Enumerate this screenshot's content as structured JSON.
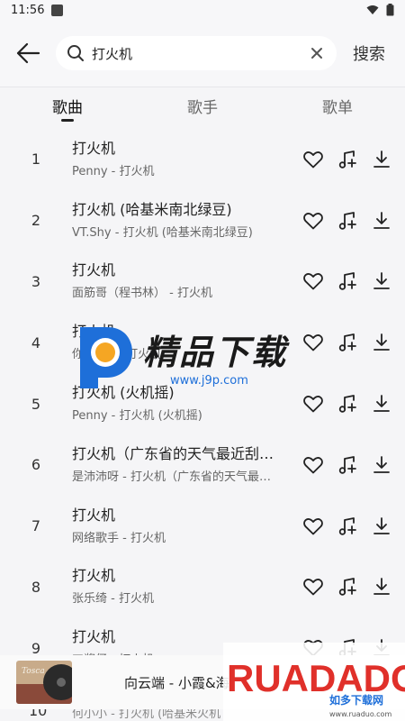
{
  "status_bar": {
    "time": "11:56"
  },
  "header": {
    "query": "打火机",
    "search_label": "搜索"
  },
  "tabs": [
    {
      "label": "歌曲",
      "active": true
    },
    {
      "label": "歌手",
      "active": false
    },
    {
      "label": "歌单",
      "active": false
    }
  ],
  "songs": [
    {
      "index": "1",
      "title": "打火机",
      "subtitle": "Penny - 打火机"
    },
    {
      "index": "2",
      "title": "打火机 (哈基米南北绿豆)",
      "subtitle": "VT.Shy - 打火机 (哈基米南北绿豆)"
    },
    {
      "index": "3",
      "title": "打火机",
      "subtitle": "面筋哥（程书林） - 打火机"
    },
    {
      "index": "4",
      "title": "打火机",
      "subtitle": "你是fr... - 打火机"
    },
    {
      "index": "5",
      "title": "打火机 (火机摇)",
      "subtitle": "Penny - 打火机 (火机摇)"
    },
    {
      "index": "6",
      "title": "打火机（广东省的天气最近刮…",
      "subtitle": "是沛沛呀 - 打火机（广东省的天气最…"
    },
    {
      "index": "7",
      "title": "打火机",
      "subtitle": "网络歌手 - 打火机"
    },
    {
      "index": "8",
      "title": "打火机",
      "subtitle": "张乐绮 - 打火机"
    },
    {
      "index": "9",
      "title": "打火机",
      "subtitle": "刀酱仔 - 打火机"
    }
  ],
  "peek_row": {
    "index": "10",
    "subtitle": "何小小 - 打火机 (哈基米火机"
  },
  "mini_player": {
    "title": "向云端 - 小霞&海",
    "cover_text": "Tosca"
  },
  "watermark_center": {
    "title": "精品下载",
    "url": "www.j9p.com"
  },
  "watermark_corner": {
    "title": "RUADADO",
    "subtitle": "如多下载网",
    "url": "www.ruaduo.com"
  },
  "colors": {
    "background": "#f5f5f7",
    "accent": "#222222",
    "watermark_blue": "#1e6fd9",
    "watermark_orange": "#f5a623",
    "watermark_red": "#e0302a"
  }
}
